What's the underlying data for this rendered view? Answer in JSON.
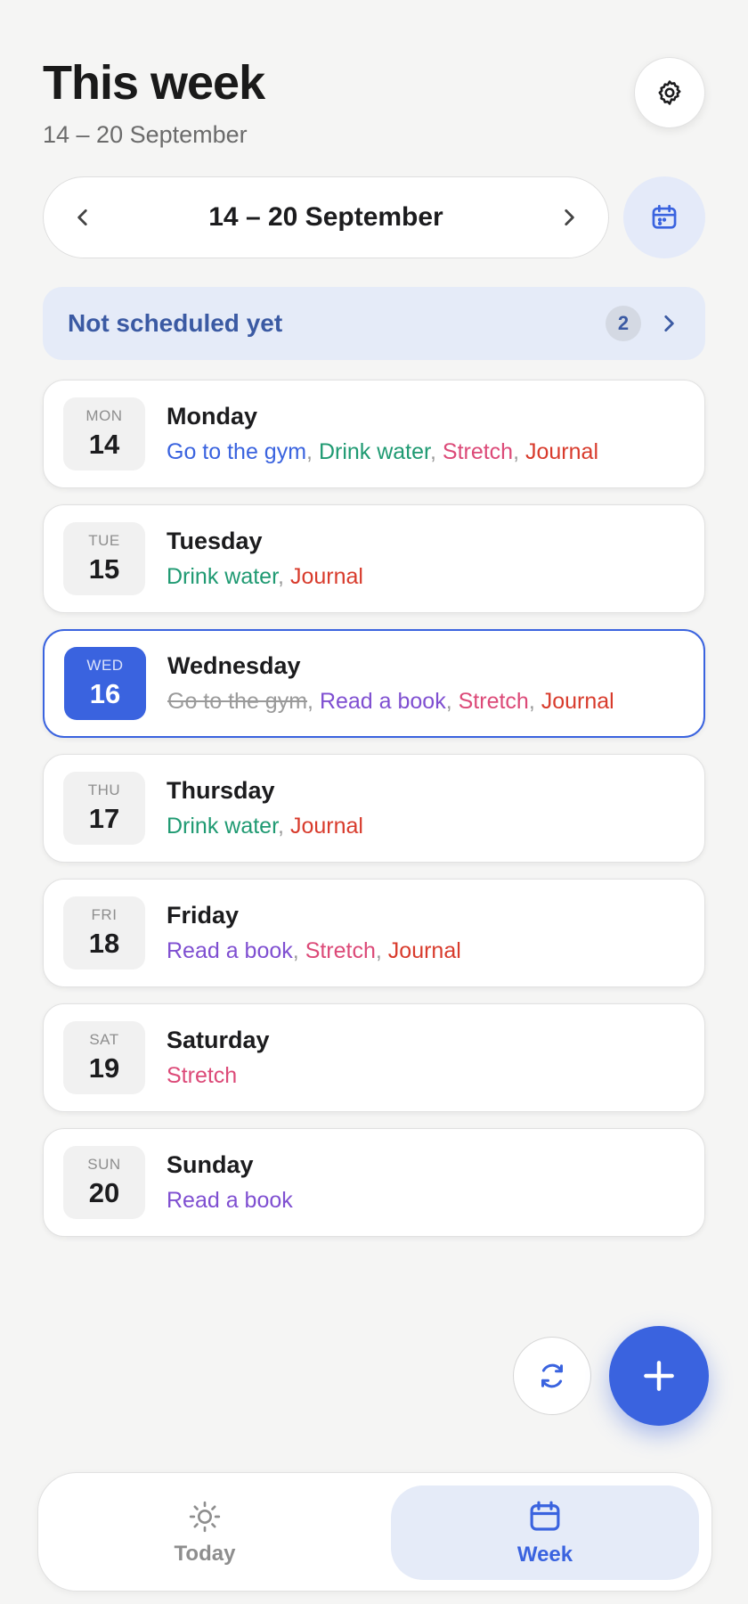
{
  "header": {
    "title": "This week",
    "subtitle": "14 – 20 September",
    "settings_icon": "gear-icon"
  },
  "week_nav": {
    "range": "14 – 20 September",
    "prev_icon": "chevron-left-icon",
    "next_icon": "chevron-right-icon",
    "calendar_icon": "calendar-icon"
  },
  "unscheduled": {
    "label": "Not scheduled yet",
    "count": "2"
  },
  "colors": {
    "accent": "#3a63df",
    "habit_gym": "#3a63df",
    "habit_water": "#1f9a72",
    "habit_stretch": "#dc4a78",
    "habit_journal": "#d83b2c",
    "habit_book": "#7f4fd1",
    "done": "#9a9a9a"
  },
  "days": [
    {
      "dow": "MON",
      "num": "14",
      "name": "Monday",
      "selected": false,
      "habits": [
        {
          "text": "Go to the gym",
          "color": "#3a63df",
          "done": false
        },
        {
          "text": "Drink water",
          "color": "#1f9a72",
          "done": false
        },
        {
          "text": "Stretch",
          "color": "#dc4a78",
          "done": false
        },
        {
          "text": "Journal",
          "color": "#d83b2c",
          "done": false
        }
      ]
    },
    {
      "dow": "TUE",
      "num": "15",
      "name": "Tuesday",
      "selected": false,
      "habits": [
        {
          "text": "Drink water",
          "color": "#1f9a72",
          "done": false
        },
        {
          "text": "Journal",
          "color": "#d83b2c",
          "done": false
        }
      ]
    },
    {
      "dow": "WED",
      "num": "16",
      "name": "Wednesday",
      "selected": true,
      "habits": [
        {
          "text": "Go to the gym",
          "color": "#9a9a9a",
          "done": true
        },
        {
          "text": "Read a book",
          "color": "#7f4fd1",
          "done": false
        },
        {
          "text": "Stretch",
          "color": "#dc4a78",
          "done": false
        },
        {
          "text": "Journal",
          "color": "#d83b2c",
          "done": false
        }
      ]
    },
    {
      "dow": "THU",
      "num": "17",
      "name": "Thursday",
      "selected": false,
      "habits": [
        {
          "text": "Drink water",
          "color": "#1f9a72",
          "done": false
        },
        {
          "text": "Journal",
          "color": "#d83b2c",
          "done": false
        }
      ]
    },
    {
      "dow": "FRI",
      "num": "18",
      "name": "Friday",
      "selected": false,
      "habits": [
        {
          "text": "Read a book",
          "color": "#7f4fd1",
          "done": false
        },
        {
          "text": "Stretch",
          "color": "#dc4a78",
          "done": false
        },
        {
          "text": "Journal",
          "color": "#d83b2c",
          "done": false
        }
      ]
    },
    {
      "dow": "SAT",
      "num": "19",
      "name": "Saturday",
      "selected": false,
      "habits": [
        {
          "text": "Stretch",
          "color": "#dc4a78",
          "done": false
        }
      ]
    },
    {
      "dow": "SUN",
      "num": "20",
      "name": "Sunday",
      "selected": false,
      "habits": [
        {
          "text": "Read a book",
          "color": "#7f4fd1",
          "done": false
        }
      ]
    }
  ],
  "fab": {
    "refresh_icon": "refresh-icon",
    "add_icon": "plus-icon"
  },
  "bottom_nav": {
    "tabs": [
      {
        "label": "Today",
        "icon": "sun-icon",
        "active": false
      },
      {
        "label": "Week",
        "icon": "calendar-icon",
        "active": true
      }
    ]
  }
}
